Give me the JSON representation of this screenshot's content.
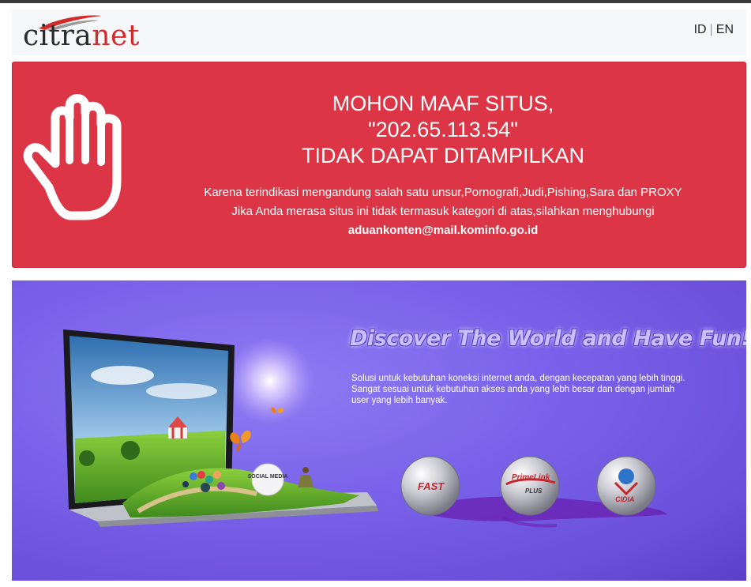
{
  "header": {
    "logo": {
      "text_part1": "citra",
      "text_part2": "net"
    },
    "language": {
      "id": "ID",
      "separator": "|",
      "en": "EN"
    }
  },
  "warning": {
    "icon": "stop-hand-icon",
    "title_line1": "MOHON MAAF SITUS,",
    "title_line2": "\"202.65.113.54\"",
    "title_line3": "TIDAK DAPAT DITAMPILKAN",
    "body_line1": "Karena terindikasi mengandung salah satu unsur,Pornografi,Judi,Pishing,Sara dan PROXY",
    "body_line2": "Jika Anda merasa situs ini tidak termasuk kategori di atas,silahkan menghubungi",
    "email": "aduankonten@mail.kominfo.go.id"
  },
  "banner": {
    "tagline": "Discover The World and Have Fun!",
    "description_line1": "Solusi untuk kebutuhan koneksi internet anda, dengan kecepatan yang lebih tinggi.",
    "description_line2": "Sangat sesuai untuk kebutuhan akses anda yang lebh besar dan dengan jumlah",
    "description_line3": "user yang lebih banyak.",
    "laptop_sticker": "SOCIAL MEDIA",
    "products": [
      {
        "label": "FAST",
        "icon": "fast-product-icon"
      },
      {
        "label_top": "PrimeLink",
        "label_bottom": "PLUS",
        "icon": "primelink-plus-icon"
      },
      {
        "label": "CIDIA",
        "icon": "cidia-globe-icon"
      }
    ]
  },
  "colors": {
    "warning_bg": "#dc3545",
    "banner_bg": "#7a63ea",
    "logo_red": "#d32a2a"
  }
}
